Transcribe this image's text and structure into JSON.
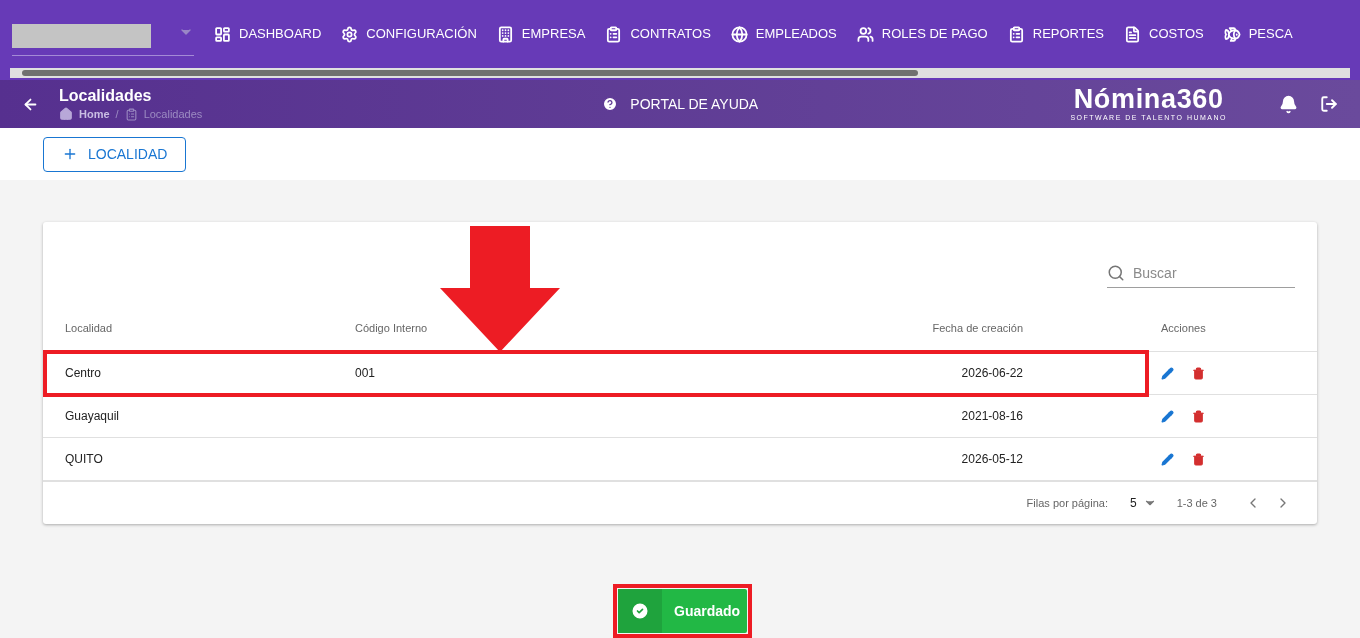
{
  "nav": [
    {
      "kind": "dashboard",
      "label": "DASHBOARD"
    },
    {
      "kind": "settings",
      "label": "CONFIGURACIÓN"
    },
    {
      "kind": "building",
      "label": "EMPRESA"
    },
    {
      "kind": "clipboard",
      "label": "CONTRATOS"
    },
    {
      "kind": "globe",
      "label": "EMPLEADOS"
    },
    {
      "kind": "users",
      "label": "ROLES DE PAGO"
    },
    {
      "kind": "clipboard",
      "label": "REPORTES"
    },
    {
      "kind": "file",
      "label": "COSTOS"
    },
    {
      "kind": "fish",
      "label": "PESCA"
    }
  ],
  "header": {
    "title": "Localidades",
    "breadcrumb": [
      "Home",
      "Localidades"
    ],
    "breadcrumb_separator": "/",
    "help": "PORTAL DE AYUDA",
    "logo": "Nómina360",
    "logo_tagline": "SOFTWARE DE TALENTO HUMANO"
  },
  "add_button": "LOCALIDAD",
  "search": {
    "placeholder": "Buscar"
  },
  "table": {
    "columns": [
      "Localidad",
      "Código Interno",
      "Fecha de creación",
      "Acciones"
    ],
    "rows": [
      {
        "cells": [
          "Centro",
          "001",
          "2026-06-22"
        ],
        "highlighted": true
      },
      {
        "cells": [
          "Guayaquil",
          "",
          "2021-08-16"
        ],
        "highlighted": false
      },
      {
        "cells": [
          "QUITO",
          "",
          "2026-05-12"
        ],
        "highlighted": false
      }
    ]
  },
  "pagination": {
    "label": "Filas por página:",
    "per_page": "5",
    "range": "1-3 de 3"
  },
  "toast": {
    "text": "Guardado",
    "highlighted": true
  }
}
